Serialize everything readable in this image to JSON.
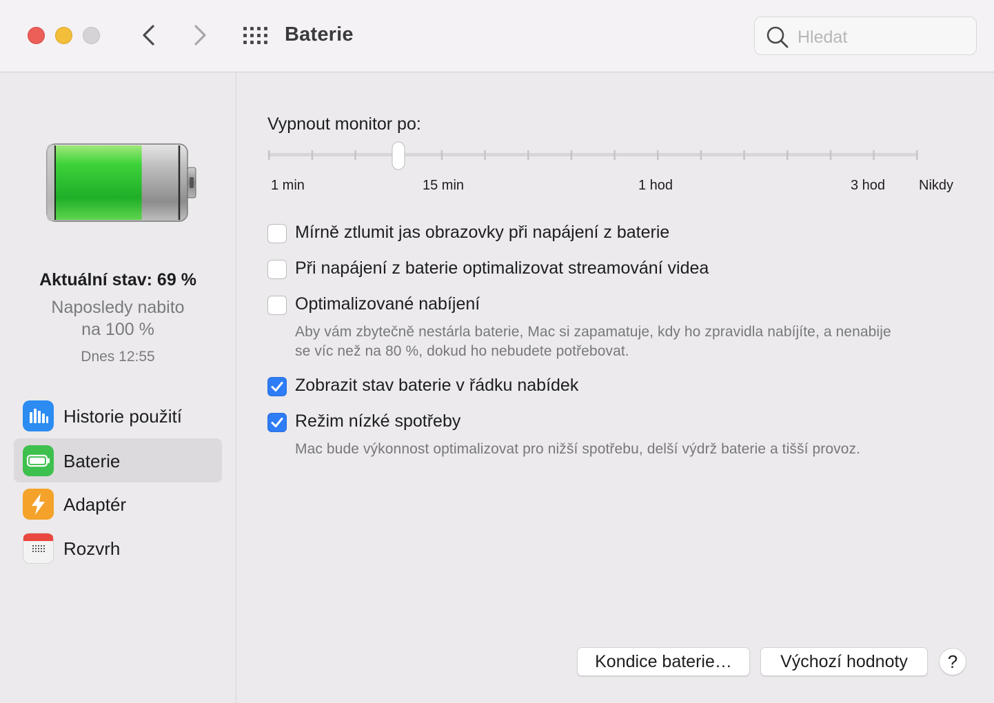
{
  "window": {
    "title": "Baterie",
    "search_placeholder": "Hledat"
  },
  "sidebar": {
    "status_main": "Aktuální stav: 69 %",
    "status_sub_line1": "Naposledy nabito",
    "status_sub_line2": "na 100 %",
    "status_time": "Dnes 12:55",
    "battery_level": 0.69,
    "items": [
      {
        "label": "Historie použití",
        "icon": "bar-chart-icon",
        "color": "#2C8CF2"
      },
      {
        "label": "Baterie",
        "icon": "battery-icon",
        "color": "#3EC04E",
        "selected": true
      },
      {
        "label": "Adaptér",
        "icon": "lightning-bolt-icon",
        "color": "#F4A22A"
      },
      {
        "label": "Rozvrh",
        "icon": "calendar-icon",
        "color": "#E9473F"
      }
    ]
  },
  "main": {
    "display_off_title": "Vypnout monitor po:",
    "slider": {
      "tick_count": 16,
      "value_index": 3,
      "labels": [
        "1 min",
        "15 min",
        "1 hod",
        "3 hod",
        "Nikdy"
      ]
    },
    "options": [
      {
        "label": "Mírně ztlumit jas obrazovky při napájení z baterie",
        "checked": false
      },
      {
        "label": "Při napájení z baterie optimalizovat streamování videa",
        "checked": false
      },
      {
        "label": "Optimalizované nabíjení",
        "checked": false,
        "description_line1": "Aby vám zbytečně nestárla baterie, Mac si zapamatuje, kdy ho zpravidla nabíjíte, a nenabije",
        "description_line2": "se víc než na 80 %, dokud ho nebudete potřebovat."
      },
      {
        "label": "Zobrazit stav baterie v řádku nabídek",
        "checked": true
      },
      {
        "label": "Režim nízké spotřeby",
        "checked": true,
        "description_line1": "Mac bude výkonnost optimalizovat pro nižší spotřebu, delší výdrž baterie a tišší provoz."
      }
    ]
  },
  "buttons": {
    "battery_health": "Kondice baterie…",
    "defaults": "Výchozí hodnoty",
    "help": "?"
  },
  "colors": {
    "accent": "#2E7CF6",
    "battery_green": "#2FC23A"
  }
}
